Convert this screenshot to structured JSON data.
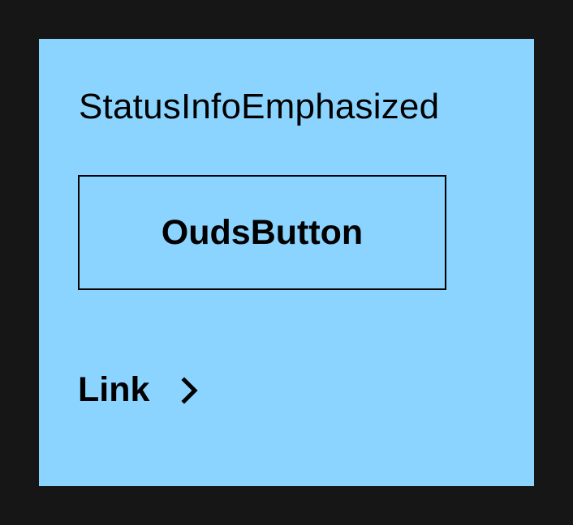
{
  "status_title": "StatusInfoEmphasized",
  "primary_button": {
    "label": "OudsButton"
  },
  "link": {
    "label": "Link",
    "icon": "chevron-right-icon"
  },
  "colors": {
    "page_background": "#161616",
    "surface": "#8ad4ff",
    "foreground": "#000000"
  }
}
